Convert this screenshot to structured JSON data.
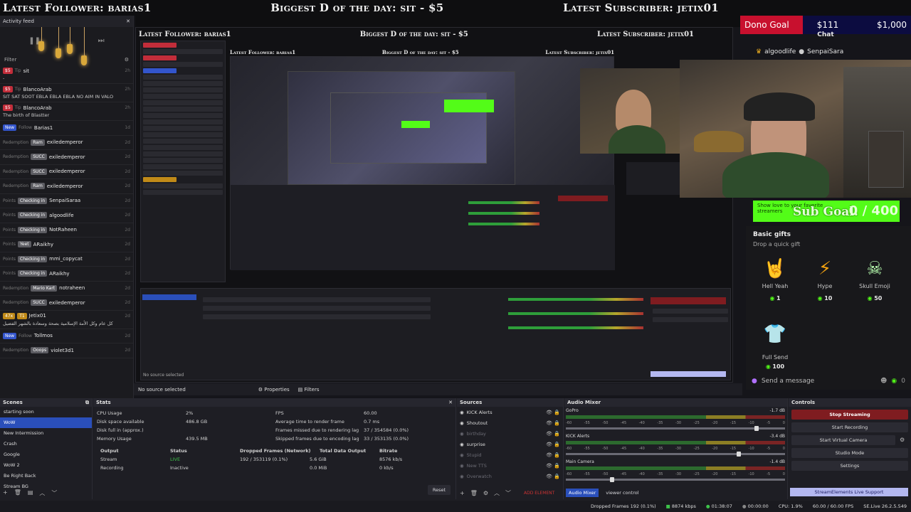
{
  "banner": {
    "left": "Latest Follower: barias1",
    "center": "Biggest D of the day: sit - $5",
    "right": "Latest Subscriber: jetix01"
  },
  "feed": {
    "title": "Activity feed",
    "filter_label": "Filter",
    "items": [
      {
        "tag": "$5",
        "type": "Tip",
        "user": "sit",
        "msg": "-",
        "age": "2h",
        "tag_color": "red"
      },
      {
        "tag": "$5",
        "type": "Tip",
        "user": "BlancoArab",
        "msg": "SIT SAT SOOT EBLA EBLA EBLA NO AIM IN VALO",
        "age": "2h",
        "tag_color": "red"
      },
      {
        "tag": "$5",
        "type": "Tip",
        "user": "BlancoArab",
        "msg": "The birth of Blastter",
        "age": "2h",
        "tag_color": "red"
      },
      {
        "tag": "New",
        "type": "Follow",
        "user": "Barias1",
        "msg": "",
        "age": "1d",
        "tag_color": "blue"
      },
      {
        "tag": "Redemption",
        "type": "Ram",
        "user": "exiledemperor",
        "msg": "",
        "age": "2d",
        "tag_color": "gray"
      },
      {
        "tag": "Redemption",
        "type": "SUCC",
        "user": "exiledemperor",
        "msg": "",
        "age": "2d",
        "tag_color": "gray"
      },
      {
        "tag": "Redemption",
        "type": "SUCC",
        "user": "exiledemperor",
        "msg": "",
        "age": "2d",
        "tag_color": "gray"
      },
      {
        "tag": "Redemption",
        "type": "Ram",
        "user": "exiledemperor",
        "msg": "",
        "age": "2d",
        "tag_color": "gray"
      },
      {
        "tag": "Points",
        "type": "Checking in",
        "user": "SenpaiSaraa",
        "msg": "",
        "age": "2d",
        "tag_color": "gray"
      },
      {
        "tag": "Points",
        "type": "Checking in",
        "user": "algoodlife",
        "msg": "",
        "age": "2d",
        "tag_color": "gray"
      },
      {
        "tag": "Points",
        "type": "Checking in",
        "user": "NotRaheen",
        "msg": "",
        "age": "2d",
        "tag_color": "gray"
      },
      {
        "tag": "Points",
        "type": "Yeet",
        "user": "ARaikhy",
        "msg": "",
        "age": "2d",
        "tag_color": "gray"
      },
      {
        "tag": "Points",
        "type": "Checking in",
        "user": "mmi_copycat",
        "msg": "",
        "age": "2d",
        "tag_color": "gray"
      },
      {
        "tag": "Points",
        "type": "Checking in",
        "user": "ARaikhy",
        "msg": "",
        "age": "2d",
        "tag_color": "gray"
      },
      {
        "tag": "Redemption",
        "type": "Mario Kart",
        "user": "notraheen",
        "msg": "",
        "age": "2d",
        "tag_color": "gray"
      },
      {
        "tag": "Redemption",
        "type": "SUCC",
        "user": "exiledemperor",
        "msg": "",
        "age": "2d",
        "tag_color": "gray"
      },
      {
        "tag": "47x",
        "type": "T1",
        "user": "Jetix01",
        "msg": "كل عام وكل الأمة الإسلامية بصحة وسعادة بالشهر الفضيل",
        "age": "2d",
        "tag_color": "gold"
      },
      {
        "tag": "New",
        "type": "Follow",
        "user": "Tollmos",
        "msg": "",
        "age": "2d",
        "tag_color": "blue"
      },
      {
        "tag": "Redemption",
        "type": "Ooops",
        "user": "violet3d1",
        "msg": "",
        "age": "2d",
        "tag_color": "gray"
      }
    ]
  },
  "dono": {
    "label": "Dono Goal",
    "current": "$111",
    "target": "$1,000"
  },
  "chat": {
    "title": "Chat",
    "users": [
      "algoodlife",
      "SenpaiSara"
    ],
    "send_placeholder": "Send a message",
    "points": "0"
  },
  "subgoal": {
    "line1": "Show love to your favorite",
    "line2": "streamers",
    "big": "Sub Goal:",
    "count": "0 / 400"
  },
  "gifts": {
    "title": "Basic gifts",
    "subtitle": "Drop a quick gift",
    "items": [
      {
        "name": "Hell Yeah",
        "price": "1",
        "icon": "rock-hand-icon"
      },
      {
        "name": "Hype",
        "price": "10",
        "icon": "lightning-icon"
      },
      {
        "name": "Skull Emoji",
        "price": "50",
        "icon": "skull-icon"
      },
      {
        "name": "Full Send",
        "price": "100",
        "icon": "tshirt-icon"
      }
    ]
  },
  "mid": {
    "no_source": "No source selected",
    "properties": "Properties",
    "filters": "Filters"
  },
  "scenes": {
    "title": "Scenes",
    "items": [
      "starting soon",
      "WoW",
      "New Intermission",
      "Crash",
      "Google",
      "WoW 2",
      "Be Right Back",
      "Stream BG"
    ],
    "active_index": 1
  },
  "stats": {
    "title": "Stats",
    "cpu_label": "CPU Usage",
    "cpu": "2%",
    "disk_label": "Disk space available",
    "disk": "486.8 GB",
    "diskfull_label": "Disk full in (approx.)",
    "diskfull": "",
    "mem_label": "Memory Usage",
    "mem": "439.5 MB",
    "fps_label": "FPS",
    "fps": "60.00",
    "render_label": "Average time to render frame",
    "render": "0.7 ms",
    "missed_label": "Frames missed due to rendering lag",
    "missed": "37 / 354584 (0.0%)",
    "skipped_label": "Skipped frames due to encoding lag",
    "skipped": "33 / 353135 (0.0%)",
    "table_headers": [
      "Output",
      "Status",
      "Dropped Frames (Network)",
      "Total Data Output",
      "Bitrate"
    ],
    "rows": [
      [
        "Stream",
        "LIVE",
        "192 / 353119 (0.1%)",
        "5.6 GiB",
        "8576 kb/s"
      ],
      [
        "Recording",
        "Inactive",
        "",
        "0.0 MiB",
        "0 kb/s"
      ]
    ],
    "reset": "Reset"
  },
  "sources": {
    "title": "Sources",
    "items": [
      {
        "name": "KICK Alerts",
        "dim": false
      },
      {
        "name": "Shoutout",
        "dim": false
      },
      {
        "name": "birthday",
        "dim": true
      },
      {
        "name": "surprise",
        "dim": false
      },
      {
        "name": "Stupid",
        "dim": true
      },
      {
        "name": "New TTS",
        "dim": true
      },
      {
        "name": "Overwatch",
        "dim": true
      }
    ],
    "add_element": "ADD ELEMENT"
  },
  "mixer": {
    "title": "Audio Mixer",
    "channels": [
      {
        "name": "GoPro",
        "db": "-1.7 dB",
        "level": 0.86
      },
      {
        "name": "KICK Alerts",
        "db": "-3.4 dB",
        "level": 0.78
      },
      {
        "name": "Main Camera",
        "db": "-1.4 dB",
        "level": 0.2
      }
    ],
    "tick_labels": [
      "-60",
      "-55",
      "-50",
      "-45",
      "-40",
      "-35",
      "-30",
      "-25",
      "-20",
      "-15",
      "-10",
      "-5",
      "0"
    ],
    "tabs": [
      "Audio Mixer",
      "viewer control"
    ]
  },
  "controls": {
    "title": "Controls",
    "buttons": [
      "Stop Streaming",
      "Start Recording",
      "Start Virtual Camera",
      "Studio Mode",
      "Settings"
    ],
    "se_support": "StreamElements Live Support"
  },
  "status": {
    "dropped": "Dropped Frames 192 (0.1%)",
    "kbps": "8874 kbps",
    "live_time": "01:38:07",
    "rec_time": "00:00:00",
    "cpu": "CPU: 1.9%",
    "fps": "60.00 / 60.00 FPS",
    "version": "SE.Live 26.2.5.549"
  }
}
